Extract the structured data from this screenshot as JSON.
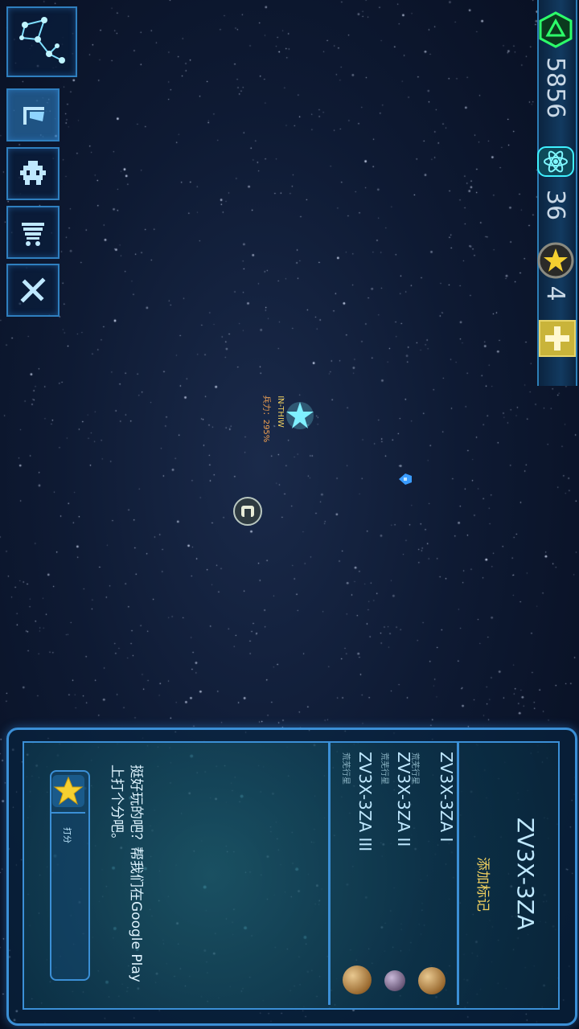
{
  "resources": {
    "credits": "5856",
    "atoms": "36",
    "stars": "4"
  },
  "map": {
    "star_name": "IN-THIW",
    "star_power": "兵力：295%"
  },
  "system": {
    "title": "ZV3X-3ZA",
    "add_mark": "添加标记",
    "planets": [
      {
        "name": "ZV3X-3ZA I",
        "type": "荒芜行星"
      },
      {
        "name": "ZV3X-3ZA II",
        "type": "荒芜行星"
      },
      {
        "name": "ZV3X-3ZA III",
        "type": "荒芜行星"
      }
    ]
  },
  "rate": {
    "message": "挺好玩的吧？帮我们在Google Play上打个分吧。",
    "button_label": "打分"
  },
  "colors": {
    "accent": "#3b8fd6",
    "gold": "#f0d060",
    "cyan": "#7ff0ff"
  }
}
